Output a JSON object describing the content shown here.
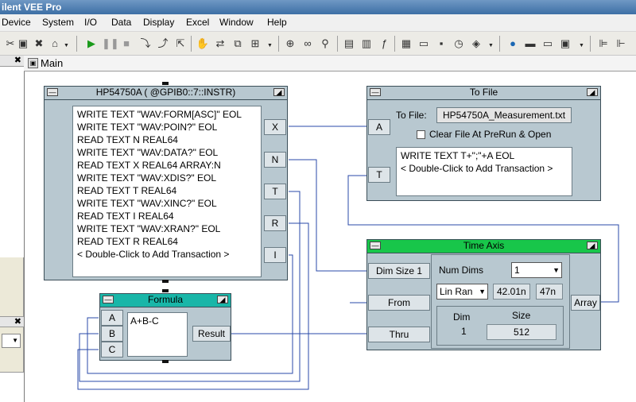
{
  "app": {
    "title": "ilent VEE Pro"
  },
  "menu": [
    "Device",
    "System",
    "I/O",
    "Data",
    "Display",
    "Excel",
    "Window",
    "Help"
  ],
  "toolbar": {
    "icons": [
      "cut-icon",
      "paste-icon",
      "delete-icon",
      "home-icon",
      "run-icon",
      "pause-icon",
      "stop-icon",
      "step-into-icon",
      "step-over-icon",
      "step-out-icon",
      "hand-icon",
      "move-icon",
      "clone-icon",
      "add-icon",
      "zoom-icon",
      "binoculars-icon",
      "find-icon",
      "display-icon",
      "numeric-icon",
      "function-icon",
      "chart-icon",
      "folder-icon",
      "disk-icon",
      "timer-icon",
      "debug-icon",
      "globe-icon",
      "panel-icon",
      "window-icon",
      "monitor-icon",
      "align-icon"
    ]
  },
  "main": {
    "title": "Main"
  },
  "hp": {
    "title": "HP54750A ( @GPIB0::7::INSTR)",
    "transactions": [
      "WRITE TEXT \"WAV:FORM[ASC]\" EOL",
      "WRITE TEXT \"WAV:POIN?\" EOL",
      "READ TEXT N REAL64",
      "WRITE TEXT \"WAV:DATA?\" EOL",
      "READ TEXT X REAL64 ARRAY:N",
      "WRITE TEXT \"WAV:XDIS?\" EOL",
      "READ TEXT T REAL64",
      "WRITE TEXT \"WAV:XINC?\" EOL",
      "READ TEXT I REAL64",
      "WRITE TEXT \"WAV:XRAN?\" EOL",
      "READ TEXT R REAL64",
      "< Double-Click to Add Transaction >"
    ],
    "outputs": [
      "X",
      "N",
      "T",
      "R",
      "I"
    ]
  },
  "tofile": {
    "title": "To File",
    "to_file_label": "To File:",
    "filename": "HP54750A_Measurement.txt",
    "clear_label": "Clear File At PreRun & Open",
    "inputs": [
      "A",
      "T"
    ],
    "transactions": [
      "WRITE TEXT T+\";\"+A EOL",
      "< Double-Click to Add Transaction >"
    ]
  },
  "timeaxis": {
    "title": "Time Axis",
    "inputs": [
      "Dim Size 1",
      "From",
      "Thru"
    ],
    "output": "Array",
    "num_dims_label": "Num Dims",
    "num_dims_value": "1",
    "mode_value": "Lin Ran",
    "from_value": "42.01n",
    "thru_value": "47n",
    "dim_header": "Dim",
    "size_header": "Size",
    "dim_value": "1",
    "size_value": "512"
  },
  "formula": {
    "title": "Formula",
    "inputs": [
      "A",
      "B",
      "C"
    ],
    "expression": "A+B-C",
    "output": "Result"
  },
  "colors": {
    "green_title": "#18c64a",
    "teal_title": "#19b6a8",
    "wire": "#2a4aa8"
  }
}
